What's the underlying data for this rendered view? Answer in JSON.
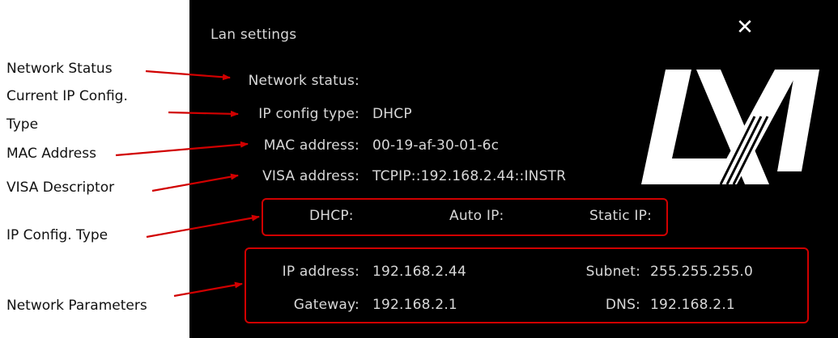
{
  "callouts": {
    "network_status": "Network Status",
    "ip_config_line1": "Current IP Config.",
    "ip_config_line2": "Type",
    "mac": "MAC Address",
    "visa": "VISA Descriptor",
    "ip_type": "IP Config. Type",
    "net_params": "Network Parameters"
  },
  "dialog": {
    "title": "Lan settings",
    "close_icon": "close-icon",
    "network_status_label": "Network status:",
    "network_status_value": "",
    "ip_config_type_label": "IP config type:",
    "ip_config_type_value": "DHCP",
    "mac_label": "MAC address:",
    "mac_value": "00-19-af-30-01-6c",
    "visa_label": "VISA address:",
    "visa_value": "TCPIP::192.168.2.44::INSTR",
    "ip_modes": {
      "dhcp": "DHCP:",
      "auto_ip": "Auto IP:",
      "static_ip": "Static IP:"
    },
    "params": {
      "ip_address_label": "IP address:",
      "ip_address_value": "192.168.2.44",
      "subnet_label": "Subnet:",
      "subnet_value": "255.255.255.0",
      "gateway_label": "Gateway:",
      "gateway_value": "192.168.2.1",
      "dns_label": "DNS:",
      "dns_value": "192.168.2.1"
    },
    "logo_text": "LXI"
  },
  "colors": {
    "panel_bg": "#000000",
    "annotation_red": "#d10000",
    "panel_text": "#d8d8d8"
  }
}
